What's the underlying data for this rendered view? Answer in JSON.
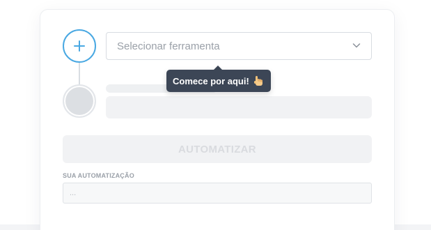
{
  "steps": {
    "first_icon": "plus-icon"
  },
  "tool_select": {
    "placeholder": "Selecionar ferramenta",
    "icon": "chevron-down-icon"
  },
  "tooltip": {
    "text": "Comece por aqui!",
    "icon": "pointing-hand-icon"
  },
  "actions": {
    "automate_label": "AUTOMATIZAR"
  },
  "output": {
    "label": "SUA AUTOMATIZAÇÃO",
    "placeholder": "..."
  },
  "colors": {
    "accent": "#49a8e2",
    "tooltip_bg": "#3c4656",
    "disabled_bg": "#f1f2f4"
  }
}
